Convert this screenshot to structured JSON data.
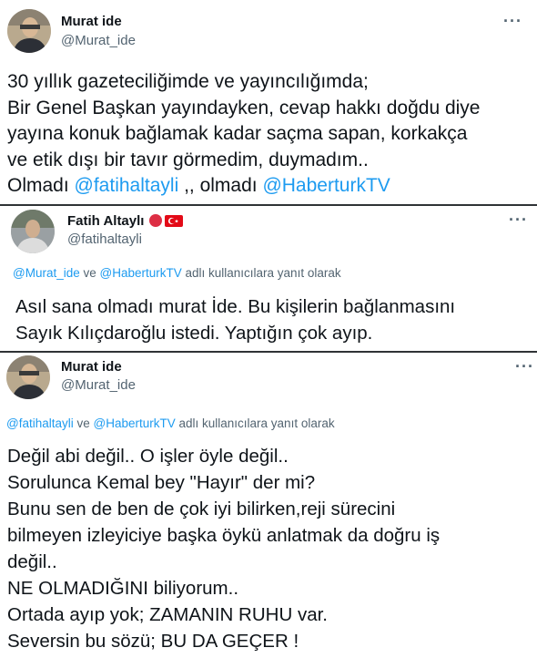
{
  "tweets": [
    {
      "name": "Murat ide",
      "handle": "@Murat_ide",
      "more_icon": "more-horizontal-icon",
      "lines": [
        "30 yıllık gazeteciliğimde ve yayıncılığımda;",
        "Bir Genel Başkan yayındayken, cevap hakkı doğdu diye",
        "yayına konuk bağlamak kadar saçma sapan, korkakça",
        "ve etik dışı bir tavır görmedim, duymadım.."
      ],
      "last_line": {
        "t1": "Olmadı ",
        "m1": "@fatihaltayli",
        "t2": " ,, olmadı ",
        "m2": "@HaberturkTV"
      }
    },
    {
      "name": "Fatih Altaylı",
      "handle": "@fatihaltayli",
      "flags": [
        "red-circle",
        "turkey-flag"
      ],
      "reply": {
        "m1": "@Murat_ide",
        "ve": " ve ",
        "m2": "@HaberturkTV",
        "suffix": " adlı kullanıcılara yanıt olarak"
      },
      "lines": [
        "Asıl sana olmadı murat İde. Bu kişilerin bağlanmasını",
        "Sayık Kılıçdaroğlu istedi.  Yaptığın çok ayıp."
      ]
    },
    {
      "name": "Murat ide",
      "handle": "@Murat_ide",
      "reply": {
        "m1": "@fatihaltayli",
        "ve": " ve ",
        "m2": "@HaberturkTV",
        "suffix": " adlı kullanıcılara yanıt olarak"
      },
      "lines": [
        "Değil abi değil.. O işler öyle değil..",
        "Sorulunca Kemal bey \"Hayır\" der mi?",
        "Bunu sen de ben de çok iyi bilirken,reji sürecini",
        "bilmeyen izleyiciye başka öykü anlatmak da doğru iş",
        "değil..",
        "NE OLMADIĞINI biliyorum..",
        "Ortada ayıp yok; ZAMANIN RUHU var.",
        "Seversin bu sözü; BU DA GEÇER !"
      ]
    }
  ],
  "colors": {
    "text": "#0f1419",
    "muted": "#536471",
    "link": "#1d9bf0"
  }
}
